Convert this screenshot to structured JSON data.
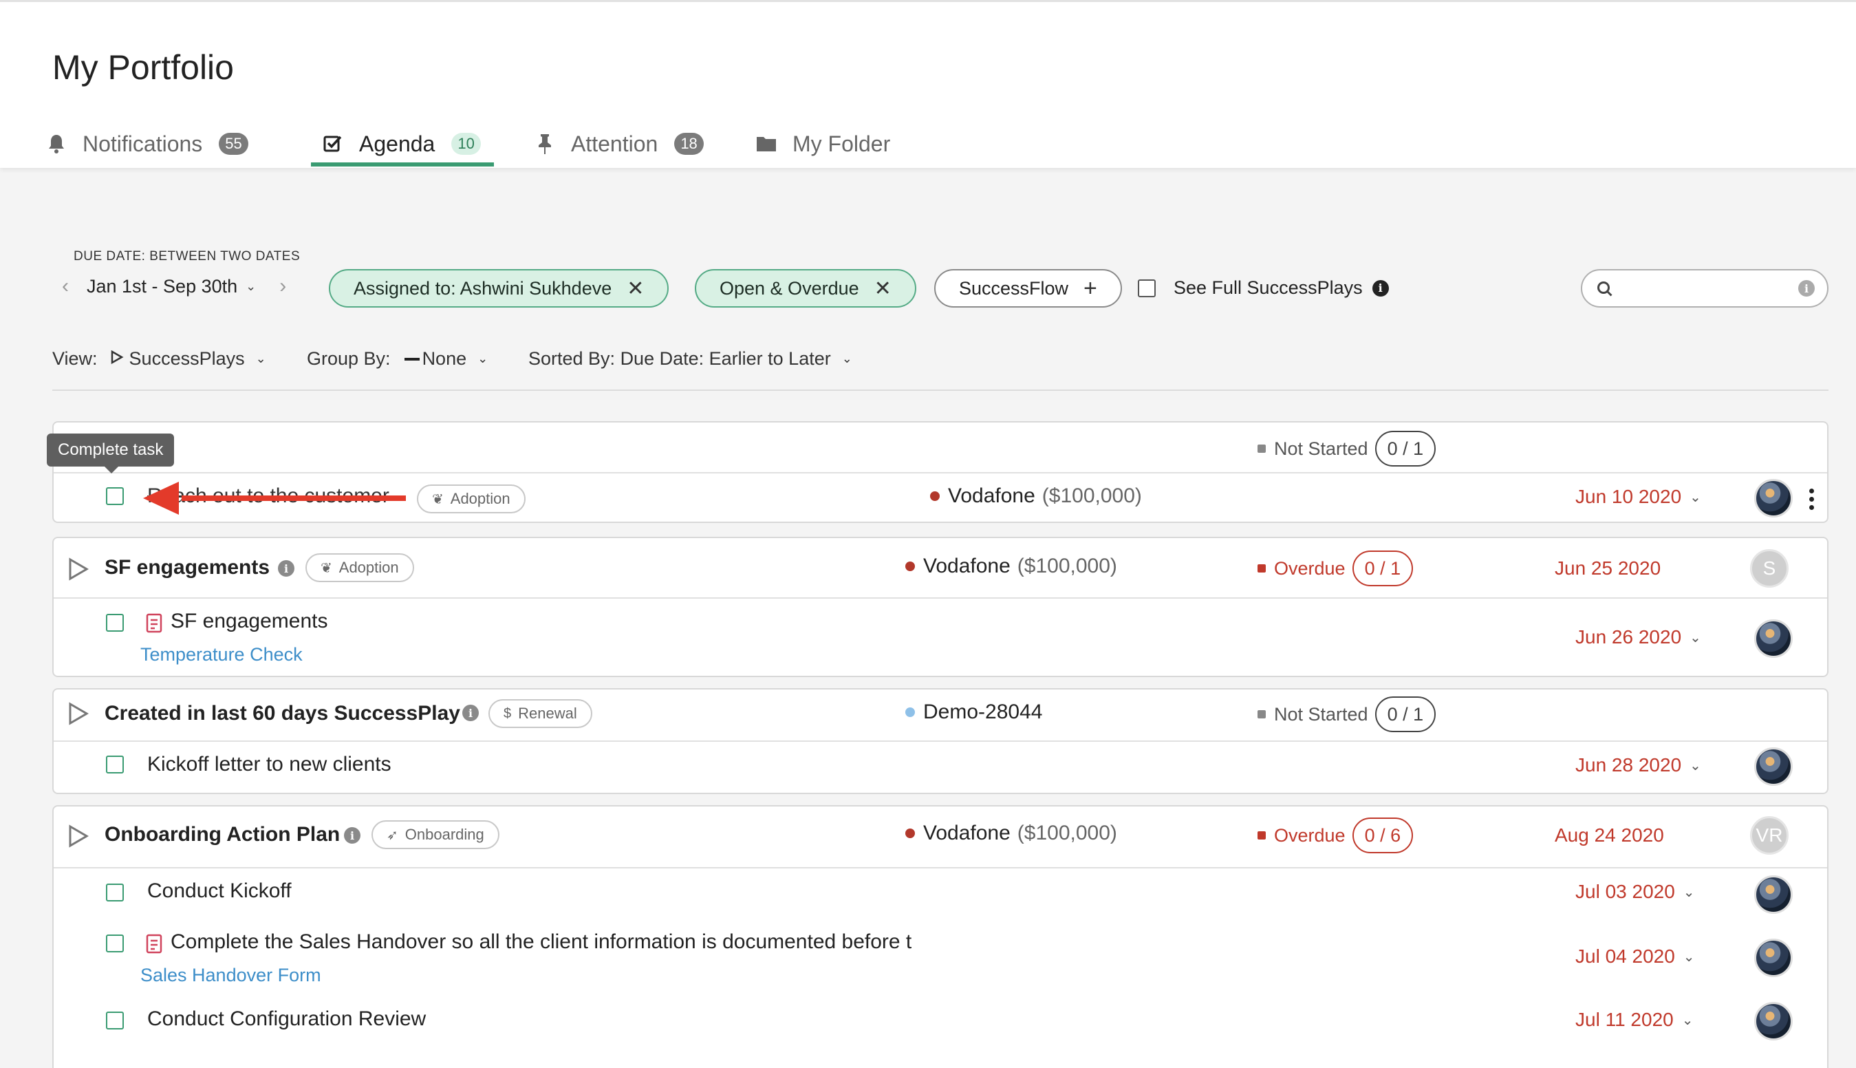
{
  "page": {
    "title": "My Portfolio"
  },
  "tabs": [
    {
      "label": "Notifications",
      "count": "55"
    },
    {
      "label": "Agenda",
      "count": "10"
    },
    {
      "label": "Attention",
      "count": "18"
    },
    {
      "label": "My Folder"
    }
  ],
  "filters": {
    "due_date_caption": "DUE DATE: BETWEEN TWO DATES",
    "date_range": "Jan 1st - Sep 30th",
    "assigned_chip": "Assigned to: Ashwini Sukhdeve",
    "status_chip": "Open & Overdue",
    "successflow_chip": "SuccessFlow",
    "see_full": "See Full SuccessPlays"
  },
  "view_bar": {
    "view_label": "View:",
    "view_value": "SuccessPlays",
    "group_label": "Group By:",
    "group_value": "None",
    "sort_label": "Sorted By: Due Date: Earlier to Later"
  },
  "tooltip": "Complete task",
  "cards": [
    {
      "play": {
        "name": "",
        "status": "Not Started",
        "progress": "0 / 1"
      },
      "tasks": [
        {
          "name": "Reach out to the customer",
          "tag": "Adoption",
          "account": "Vodafone",
          "amount": "($100,000)",
          "due": "Jun 10 2020"
        }
      ]
    },
    {
      "play": {
        "name": "SF engagements",
        "tag": "Adoption",
        "account": "Vodafone",
        "amount": "($100,000)",
        "status": "Overdue",
        "progress": "0 / 1",
        "due": "Jun 25 2020",
        "avatar": "S"
      },
      "tasks": [
        {
          "name": "SF engagements",
          "link": "Temperature Check",
          "due": "Jun 26 2020"
        }
      ]
    },
    {
      "play": {
        "name": "Created in last 60 days SuccessPlay",
        "tag": "Renewal",
        "account": "Demo-28044",
        "status": "Not Started",
        "progress": "0 / 1"
      },
      "tasks": [
        {
          "name": "Kickoff letter to new clients",
          "due": "Jun 28 2020"
        }
      ]
    },
    {
      "play": {
        "name": "Onboarding Action Plan",
        "tag": "Onboarding",
        "account": "Vodafone",
        "amount": "($100,000)",
        "status": "Overdue",
        "progress": "0 / 6",
        "due": "Aug 24 2020",
        "avatar": "VR"
      },
      "tasks": [
        {
          "name": "Conduct Kickoff",
          "due": "Jul 03 2020"
        },
        {
          "name": "Complete the Sales Handover so all the client information is documented before t",
          "link": "Sales Handover Form",
          "due": "Jul 04 2020"
        },
        {
          "name": "Conduct Configuration Review",
          "due": "Jul 11 2020"
        }
      ]
    }
  ],
  "colors": {
    "accent": "#3a9b72",
    "overdue": "#c0392b",
    "link": "#3d8ec9"
  }
}
